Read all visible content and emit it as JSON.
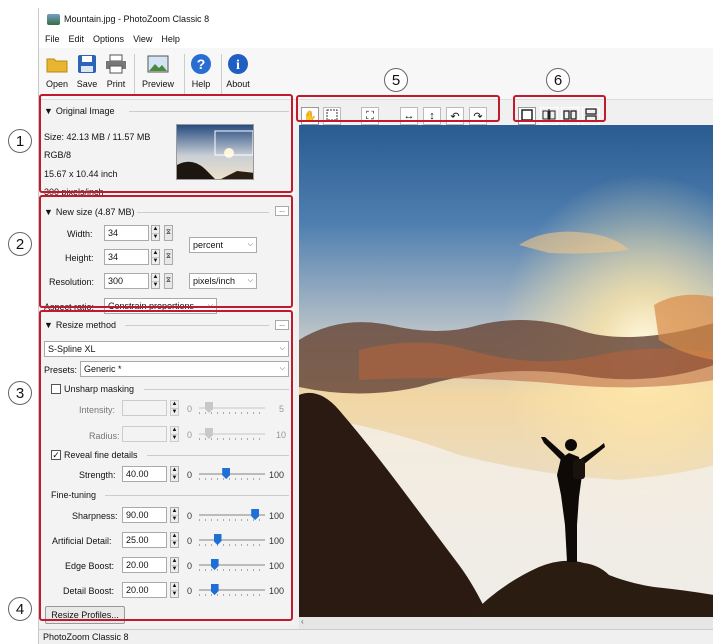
{
  "window": {
    "title": "Mountain.jpg - PhotoZoom Classic 8"
  },
  "menu": [
    "File",
    "Edit",
    "Options",
    "View",
    "Help"
  ],
  "toolbar": {
    "open": "Open",
    "save": "Save",
    "print": "Print",
    "preview": "Preview",
    "help": "Help",
    "about": "About"
  },
  "original": {
    "title": "Original Image",
    "size": "Size: 42.13 MB / 11.57 MB",
    "mode": "RGB/8",
    "dims": "15.67 x 10.44 inch",
    "res": "300 pixels/inch"
  },
  "newsize": {
    "title": "New size (4.87 MB)",
    "width_label": "Width:",
    "width": "34",
    "height_label": "Height:",
    "height": "34",
    "unit": "percent",
    "res_label": "Resolution:",
    "res": "300",
    "res_unit": "pixels/inch",
    "aspect_label": "Aspect ratio:",
    "aspect": "Constrain proportions"
  },
  "resize": {
    "title": "Resize method",
    "method": "S-Spline XL",
    "presets_label": "Presets:",
    "preset": "Generic *",
    "unsharp": "Unsharp masking",
    "intensity_label": "Intensity:",
    "intensity_zero": "0",
    "intensity_max": "5",
    "radius_label": "Radius:",
    "radius_zero": "0",
    "radius_max": "10",
    "reveal": "Reveal fine details",
    "strength_label": "Strength:",
    "strength": "40.00",
    "strength_zero": "0",
    "strength_max": "100",
    "strength_level": 0.4,
    "finetuning": "Fine-tuning",
    "sharpness_label": "Sharpness:",
    "sharpness": "90.00",
    "sharpness_zero": "0",
    "sharpness_max": "100",
    "sharpness_level": 0.9,
    "artificial_label": "Artificial Detail:",
    "artificial": "25.00",
    "artificial_zero": "0",
    "artificial_max": "100",
    "artificial_level": 0.25,
    "edge_label": "Edge Boost:",
    "edge": "20.00",
    "edge_zero": "0",
    "edge_max": "100",
    "edge_level": 0.2,
    "detail_label": "Detail Boost:",
    "detail": "20.00",
    "detail_zero": "0",
    "detail_max": "100",
    "detail_level": 0.2,
    "profiles_button": "Resize Profiles...",
    "more": "..."
  },
  "callouts": [
    "1",
    "2",
    "3",
    "4",
    "5",
    "6"
  ],
  "status": "PhotoZoom Classic 8",
  "colors": {
    "callout_border": "#c01a2c",
    "slider_thumb": "#1e6fd6"
  }
}
